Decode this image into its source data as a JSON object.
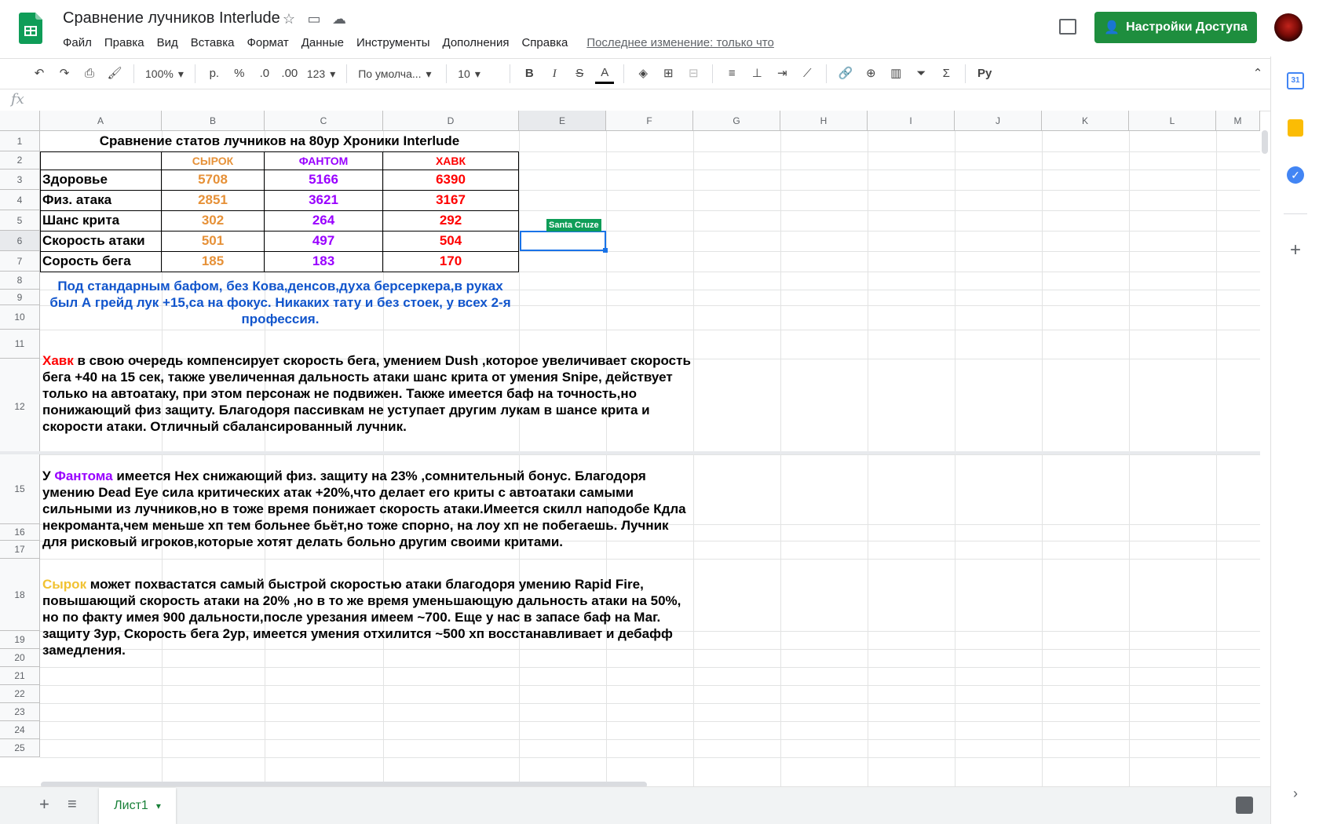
{
  "app": {
    "doc_title": "Сравнение лучников Interlude",
    "menu": [
      "Файл",
      "Правка",
      "Вид",
      "Вставка",
      "Формат",
      "Данные",
      "Инструменты",
      "Дополнения",
      "Справка"
    ],
    "last_edit": "Последнее изменение: только что",
    "share_label": "Настройки Доступа"
  },
  "toolbar": {
    "zoom": "100%",
    "currency": "р.",
    "percent": "%",
    "dec_less": ".0",
    "dec_more": ".00",
    "format_more": "123",
    "font": "По умолча...",
    "size": "10"
  },
  "formula_bar": {
    "fx": "fx"
  },
  "columns": [
    "A",
    "B",
    "C",
    "D",
    "E",
    "F",
    "G",
    "H",
    "I",
    "J",
    "K",
    "L",
    "M"
  ],
  "rows": [
    "1",
    "2",
    "3",
    "4",
    "5",
    "6",
    "7",
    "8",
    "9",
    "10",
    "11",
    "12",
    "15",
    "16",
    "17",
    "18",
    "19",
    "20",
    "21",
    "22",
    "23",
    "24",
    "25"
  ],
  "table": {
    "title": "Сравнение статов лучников на 80ур Хроники Interlude",
    "headers": [
      "СЫРОК",
      "ФАНТОМ",
      "ХАВК"
    ],
    "rows": [
      {
        "label": "Здоровье",
        "values": [
          "5708",
          "5166",
          "6390"
        ]
      },
      {
        "label": "Физ. атака",
        "values": [
          "2851",
          "3621",
          "3167"
        ]
      },
      {
        "label": "Шанс крита",
        "values": [
          "302",
          "264",
          "292"
        ]
      },
      {
        "label": "Скорость атаки",
        "values": [
          "501",
          "497",
          "504"
        ]
      },
      {
        "label": "Сорость бега",
        "values": [
          "185",
          "183",
          "170"
        ]
      }
    ],
    "note": "Под стандарным бафом, без Кова,денсов,духа берсеркера,в руках был А грейд лук +15,са на фокус. Никаких тату и без стоек, у всех 2-я профессия."
  },
  "collaborator": "Santa Cruze",
  "paragraphs": {
    "hawk_name": "Хавк",
    "hawk_text": " в свою очередь компенсирует скорость бега, умением Dush ,которое увеличивает скорость бега +40 на 15 сек, также увеличенная дальность атаки шанс крита от умения Snipe, действует только на автоатаку, при этом персонаж не подвижен. Также имеется баф на точность,но понижающий физ защиту. Благодоря пассивкам не уступает другим лукам в шансе крита и скорости атаки. Отличный сбалансированный лучник.",
    "phantom_prefix": "У ",
    "phantom_name": "Фантома",
    "phantom_text": " имеется Hex снижающий физ. защиту на 23% ,сомнительный бонус. Благодоря умению Dead Eye сила критических атак +20%,что делает его криты с автоатаки самыми сильными из лучников,но в тоже время понижает скорость атаки.Имеется скилл наподобе Кдла некроманта,чем меньше хп тем больнее бьёт,но тоже спорно, на лоу хп не побегаешь. Лучник для рисковый игроков,которые хотят делать больно другим своими критами.",
    "syrok_name": "Сырок",
    "syrok_text": " может похвастатся самый быстрой скоростью атаки благодоря умению Rapid Fire, повышающий скорость атаки на 20% ,но в то же время уменьшающую дальность атаки на 50%, но по факту имея 900 дальности,после урезания имеем ~700. Еще у нас в запасе баф на Маг. защиту 3ур, Скорость бега 2ур, имеется умения отхилится ~500 хп восстанавливает и дебафф замедления."
  },
  "sheet_tab": "Лист1",
  "colors": {
    "syrok": "#e69138",
    "phantom": "#9900ff",
    "hawk": "#ff0000",
    "note": "#1155cc",
    "share": "#1e8e3e",
    "collab": "#0f9d58"
  }
}
